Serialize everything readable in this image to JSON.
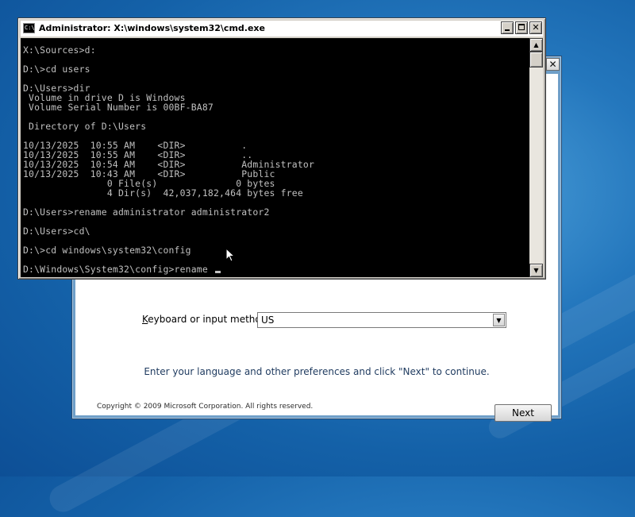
{
  "cmd": {
    "icon_text": "C:\\",
    "title": "Administrator: X:\\windows\\system32\\cmd.exe",
    "lines": [
      "X:\\Sources>d:",
      "",
      "D:\\>cd users",
      "",
      "D:\\Users>dir",
      " Volume in drive D is Windows",
      " Volume Serial Number is 00BF-BA87",
      "",
      " Directory of D:\\Users",
      "",
      "10/13/2025  10:55 AM    <DIR>          .",
      "10/13/2025  10:55 AM    <DIR>          ..",
      "10/13/2025  10:54 AM    <DIR>          Administrator",
      "10/13/2025  10:43 AM    <DIR>          Public",
      "               0 File(s)              0 bytes",
      "               4 Dir(s)  42,037,182,464 bytes free",
      "",
      "D:\\Users>rename administrator administrator2",
      "",
      "D:\\Users>cd\\",
      "",
      "D:\\>cd windows\\system32\\config",
      "",
      "D:\\Windows\\System32\\config>rename "
    ],
    "scroll_up_glyph": "▲",
    "scroll_down_glyph": "▼",
    "close_glyph": "✕"
  },
  "setup": {
    "close_glyph": "✕",
    "keyboard_label_prefix": "",
    "keyboard_label_accel": "K",
    "keyboard_label_rest": "eyboard or input method:",
    "keyboard_value": "US",
    "dropdown_glyph": "▼",
    "hint": "Enter your language and other preferences and click \"Next\" to continue.",
    "copyright": "Copyright © 2009 Microsoft Corporation. All rights reserved.",
    "next_label": "Next"
  }
}
